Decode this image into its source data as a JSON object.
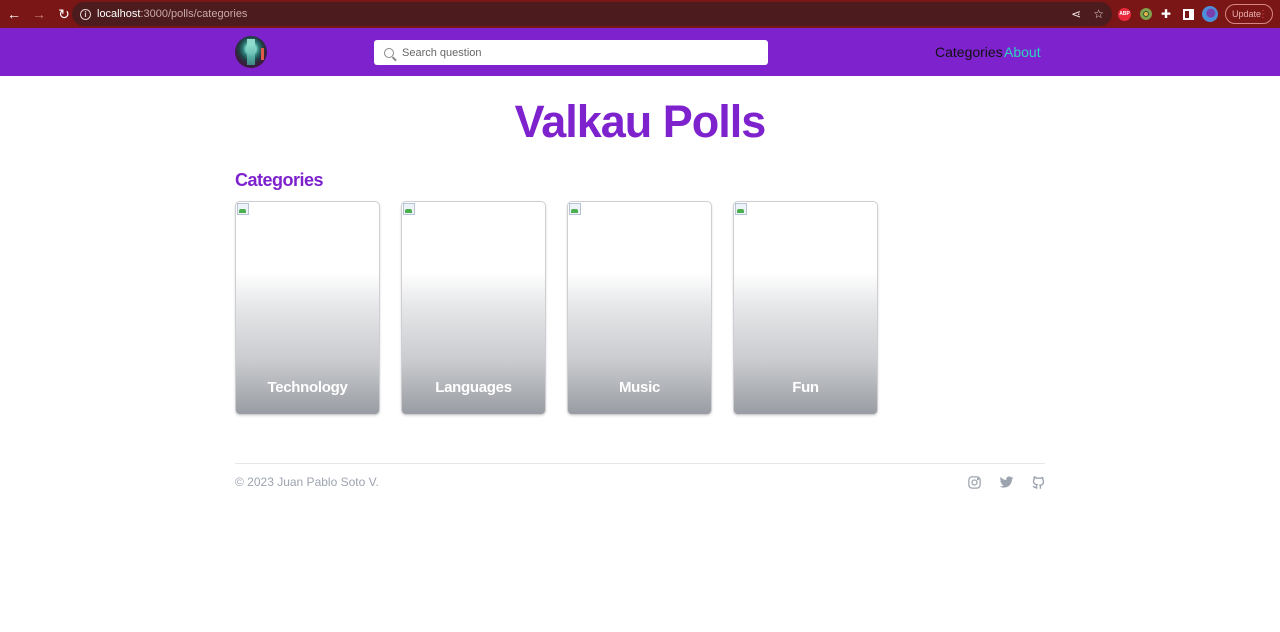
{
  "browser": {
    "url_host": "localhost",
    "url_path": ":3000/polls/categories",
    "update_label": "Update",
    "extensions": [
      "adblock-icon",
      "target-extension-icon",
      "puzzle-extensions-icon",
      "side-panel-icon",
      "profile-avatar"
    ]
  },
  "navbar": {
    "search_placeholder": "Search question",
    "search_value": "",
    "links": [
      {
        "label": "Categories",
        "color": "#111111"
      },
      {
        "label": "About",
        "color": "#2dd4bf"
      }
    ],
    "background": "#7e22ce"
  },
  "main": {
    "title": "Valkau Polls",
    "section_title": "Categories",
    "categories": [
      {
        "label": "Technology",
        "image": "broken-image"
      },
      {
        "label": "Languages",
        "image": "broken-image"
      },
      {
        "label": "Music",
        "image": "broken-image"
      },
      {
        "label": "Fun",
        "image": "broken-image"
      }
    ]
  },
  "footer": {
    "copyright": "© 2023 Juan Pablo Soto V.",
    "social": [
      "instagram-icon",
      "twitter-icon",
      "github-icon"
    ]
  },
  "colors": {
    "brand": "#7e22ce",
    "accent": "#2dd4bf",
    "footer_text": "#9ca3af"
  }
}
